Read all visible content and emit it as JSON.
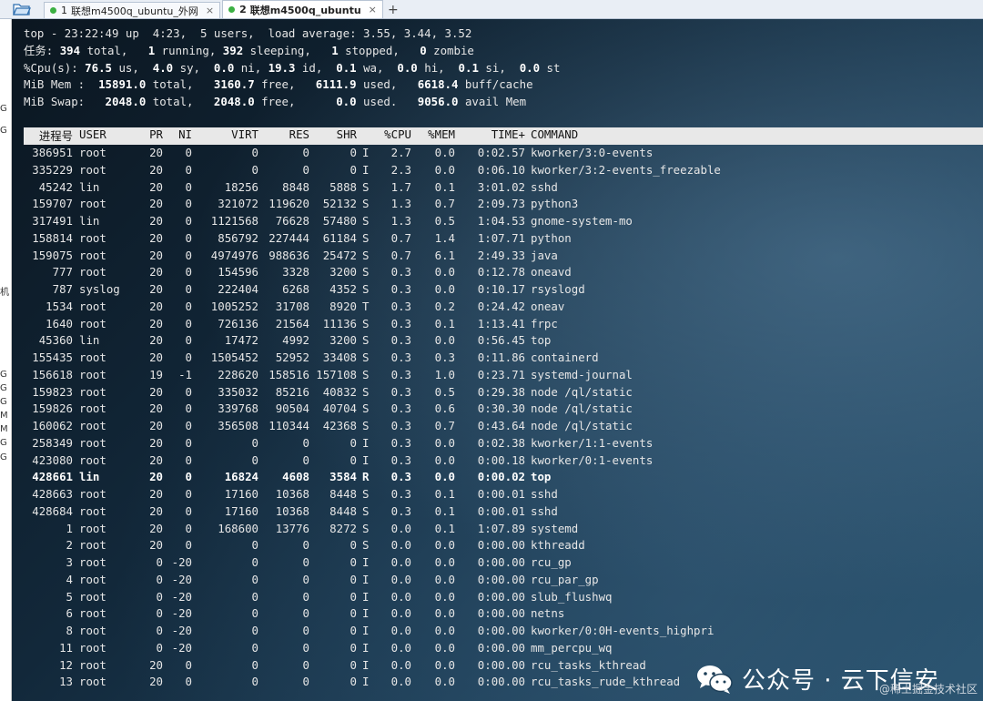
{
  "tabs": [
    {
      "index": "1",
      "label": "联想m4500q_ubuntu_外网",
      "active": false,
      "close": "×"
    },
    {
      "index": "2",
      "label": "联想m4500q_ubuntu",
      "active": true,
      "close": "×"
    }
  ],
  "add_tab": "+",
  "left_strip_chars": [
    "G",
    "G",
    "机",
    "G",
    "G",
    "G",
    "M",
    "M",
    "G",
    "G"
  ],
  "summary": {
    "line1": "top - 23:22:49 up  4:23,  5 users,  load average: 3.55, 3.44, 3.52",
    "tasks": {
      "label": "任务:",
      "total": "394",
      "total_lbl": " total,",
      "running": "1",
      "running_lbl": " running,",
      "sleeping": "392",
      "sleeping_lbl": " sleeping,",
      "stopped": "1",
      "stopped_lbl": " stopped,",
      "zombie": "0",
      "zombie_lbl": " zombie"
    },
    "cpu": {
      "label": "%Cpu(s):",
      "us": "76.5",
      "sy": "4.0",
      "ni": "0.0",
      "id": "19.3",
      "wa": "0.1",
      "hi": "0.0",
      "si": "0.1",
      "st": "0.0"
    },
    "mem": {
      "label": "MiB Mem :",
      "total": "15891.0",
      "free": "3160.7",
      "used": "6111.9",
      "buff": "6618.4"
    },
    "swap": {
      "label": "MiB Swap:",
      "total": "2048.0",
      "free": "2048.0",
      "used": "0.0",
      "avail": "9056.0"
    }
  },
  "columns": {
    "pid": "进程号",
    "user": "USER",
    "pr": "PR",
    "ni": "NI",
    "virt": "VIRT",
    "res": "RES",
    "shr": "SHR",
    "s": "",
    "cpu": "%CPU",
    "mem": "%MEM",
    "time": "TIME+",
    "cmd": "COMMAND"
  },
  "processes": [
    {
      "pid": "386951",
      "user": "root",
      "pr": "20",
      "ni": "0",
      "virt": "0",
      "res": "0",
      "shr": "0",
      "s": "I",
      "cpu": "2.7",
      "mem": "0.0",
      "time": "0:02.57",
      "cmd": "kworker/3:0-events"
    },
    {
      "pid": "335229",
      "user": "root",
      "pr": "20",
      "ni": "0",
      "virt": "0",
      "res": "0",
      "shr": "0",
      "s": "I",
      "cpu": "2.3",
      "mem": "0.0",
      "time": "0:06.10",
      "cmd": "kworker/3:2-events_freezable"
    },
    {
      "pid": "45242",
      "user": "lin",
      "pr": "20",
      "ni": "0",
      "virt": "18256",
      "res": "8848",
      "shr": "5888",
      "s": "S",
      "cpu": "1.7",
      "mem": "0.1",
      "time": "3:01.02",
      "cmd": "sshd"
    },
    {
      "pid": "159707",
      "user": "root",
      "pr": "20",
      "ni": "0",
      "virt": "321072",
      "res": "119620",
      "shr": "52132",
      "s": "S",
      "cpu": "1.3",
      "mem": "0.7",
      "time": "2:09.73",
      "cmd": "python3"
    },
    {
      "pid": "317491",
      "user": "lin",
      "pr": "20",
      "ni": "0",
      "virt": "1121568",
      "res": "76628",
      "shr": "57480",
      "s": "S",
      "cpu": "1.3",
      "mem": "0.5",
      "time": "1:04.53",
      "cmd": "gnome-system-mo"
    },
    {
      "pid": "158814",
      "user": "root",
      "pr": "20",
      "ni": "0",
      "virt": "856792",
      "res": "227444",
      "shr": "61184",
      "s": "S",
      "cpu": "0.7",
      "mem": "1.4",
      "time": "1:07.71",
      "cmd": "python"
    },
    {
      "pid": "159075",
      "user": "root",
      "pr": "20",
      "ni": "0",
      "virt": "4974976",
      "res": "988636",
      "shr": "25472",
      "s": "S",
      "cpu": "0.7",
      "mem": "6.1",
      "time": "2:49.33",
      "cmd": "java"
    },
    {
      "pid": "777",
      "user": "root",
      "pr": "20",
      "ni": "0",
      "virt": "154596",
      "res": "3328",
      "shr": "3200",
      "s": "S",
      "cpu": "0.3",
      "mem": "0.0",
      "time": "0:12.78",
      "cmd": "oneavd"
    },
    {
      "pid": "787",
      "user": "syslog",
      "pr": "20",
      "ni": "0",
      "virt": "222404",
      "res": "6268",
      "shr": "4352",
      "s": "S",
      "cpu": "0.3",
      "mem": "0.0",
      "time": "0:10.17",
      "cmd": "rsyslogd"
    },
    {
      "pid": "1534",
      "user": "root",
      "pr": "20",
      "ni": "0",
      "virt": "1005252",
      "res": "31708",
      "shr": "8920",
      "s": "T",
      "cpu": "0.3",
      "mem": "0.2",
      "time": "0:24.42",
      "cmd": "oneav"
    },
    {
      "pid": "1640",
      "user": "root",
      "pr": "20",
      "ni": "0",
      "virt": "726136",
      "res": "21564",
      "shr": "11136",
      "s": "S",
      "cpu": "0.3",
      "mem": "0.1",
      "time": "1:13.41",
      "cmd": "frpc"
    },
    {
      "pid": "45360",
      "user": "lin",
      "pr": "20",
      "ni": "0",
      "virt": "17472",
      "res": "4992",
      "shr": "3200",
      "s": "S",
      "cpu": "0.3",
      "mem": "0.0",
      "time": "0:56.45",
      "cmd": "top"
    },
    {
      "pid": "155435",
      "user": "root",
      "pr": "20",
      "ni": "0",
      "virt": "1505452",
      "res": "52952",
      "shr": "33408",
      "s": "S",
      "cpu": "0.3",
      "mem": "0.3",
      "time": "0:11.86",
      "cmd": "containerd"
    },
    {
      "pid": "156618",
      "user": "root",
      "pr": "19",
      "ni": "-1",
      "virt": "228620",
      "res": "158516",
      "shr": "157108",
      "s": "S",
      "cpu": "0.3",
      "mem": "1.0",
      "time": "0:23.71",
      "cmd": "systemd-journal"
    },
    {
      "pid": "159823",
      "user": "root",
      "pr": "20",
      "ni": "0",
      "virt": "335032",
      "res": "85216",
      "shr": "40832",
      "s": "S",
      "cpu": "0.3",
      "mem": "0.5",
      "time": "0:29.38",
      "cmd": "node /ql/static"
    },
    {
      "pid": "159826",
      "user": "root",
      "pr": "20",
      "ni": "0",
      "virt": "339768",
      "res": "90504",
      "shr": "40704",
      "s": "S",
      "cpu": "0.3",
      "mem": "0.6",
      "time": "0:30.30",
      "cmd": "node /ql/static"
    },
    {
      "pid": "160062",
      "user": "root",
      "pr": "20",
      "ni": "0",
      "virt": "356508",
      "res": "110344",
      "shr": "42368",
      "s": "S",
      "cpu": "0.3",
      "mem": "0.7",
      "time": "0:43.64",
      "cmd": "node /ql/static"
    },
    {
      "pid": "258349",
      "user": "root",
      "pr": "20",
      "ni": "0",
      "virt": "0",
      "res": "0",
      "shr": "0",
      "s": "I",
      "cpu": "0.3",
      "mem": "0.0",
      "time": "0:02.38",
      "cmd": "kworker/1:1-events"
    },
    {
      "pid": "423080",
      "user": "root",
      "pr": "20",
      "ni": "0",
      "virt": "0",
      "res": "0",
      "shr": "0",
      "s": "I",
      "cpu": "0.3",
      "mem": "0.0",
      "time": "0:00.18",
      "cmd": "kworker/0:1-events"
    },
    {
      "pid": "428661",
      "user": "lin",
      "pr": "20",
      "ni": "0",
      "virt": "16824",
      "res": "4608",
      "shr": "3584",
      "s": "R",
      "cpu": "0.3",
      "mem": "0.0",
      "time": "0:00.02",
      "cmd": "top",
      "bold": true
    },
    {
      "pid": "428663",
      "user": "root",
      "pr": "20",
      "ni": "0",
      "virt": "17160",
      "res": "10368",
      "shr": "8448",
      "s": "S",
      "cpu": "0.3",
      "mem": "0.1",
      "time": "0:00.01",
      "cmd": "sshd"
    },
    {
      "pid": "428684",
      "user": "root",
      "pr": "20",
      "ni": "0",
      "virt": "17160",
      "res": "10368",
      "shr": "8448",
      "s": "S",
      "cpu": "0.3",
      "mem": "0.1",
      "time": "0:00.01",
      "cmd": "sshd"
    },
    {
      "pid": "1",
      "user": "root",
      "pr": "20",
      "ni": "0",
      "virt": "168600",
      "res": "13776",
      "shr": "8272",
      "s": "S",
      "cpu": "0.0",
      "mem": "0.1",
      "time": "1:07.89",
      "cmd": "systemd"
    },
    {
      "pid": "2",
      "user": "root",
      "pr": "20",
      "ni": "0",
      "virt": "0",
      "res": "0",
      "shr": "0",
      "s": "S",
      "cpu": "0.0",
      "mem": "0.0",
      "time": "0:00.00",
      "cmd": "kthreadd"
    },
    {
      "pid": "3",
      "user": "root",
      "pr": "0",
      "ni": "-20",
      "virt": "0",
      "res": "0",
      "shr": "0",
      "s": "I",
      "cpu": "0.0",
      "mem": "0.0",
      "time": "0:00.00",
      "cmd": "rcu_gp"
    },
    {
      "pid": "4",
      "user": "root",
      "pr": "0",
      "ni": "-20",
      "virt": "0",
      "res": "0",
      "shr": "0",
      "s": "I",
      "cpu": "0.0",
      "mem": "0.0",
      "time": "0:00.00",
      "cmd": "rcu_par_gp"
    },
    {
      "pid": "5",
      "user": "root",
      "pr": "0",
      "ni": "-20",
      "virt": "0",
      "res": "0",
      "shr": "0",
      "s": "I",
      "cpu": "0.0",
      "mem": "0.0",
      "time": "0:00.00",
      "cmd": "slub_flushwq"
    },
    {
      "pid": "6",
      "user": "root",
      "pr": "0",
      "ni": "-20",
      "virt": "0",
      "res": "0",
      "shr": "0",
      "s": "I",
      "cpu": "0.0",
      "mem": "0.0",
      "time": "0:00.00",
      "cmd": "netns"
    },
    {
      "pid": "8",
      "user": "root",
      "pr": "0",
      "ni": "-20",
      "virt": "0",
      "res": "0",
      "shr": "0",
      "s": "I",
      "cpu": "0.0",
      "mem": "0.0",
      "time": "0:00.00",
      "cmd": "kworker/0:0H-events_highpri"
    },
    {
      "pid": "11",
      "user": "root",
      "pr": "0",
      "ni": "-20",
      "virt": "0",
      "res": "0",
      "shr": "0",
      "s": "I",
      "cpu": "0.0",
      "mem": "0.0",
      "time": "0:00.00",
      "cmd": "mm_percpu_wq"
    },
    {
      "pid": "12",
      "user": "root",
      "pr": "20",
      "ni": "0",
      "virt": "0",
      "res": "0",
      "shr": "0",
      "s": "I",
      "cpu": "0.0",
      "mem": "0.0",
      "time": "0:00.00",
      "cmd": "rcu_tasks_kthread"
    },
    {
      "pid": "13",
      "user": "root",
      "pr": "20",
      "ni": "0",
      "virt": "0",
      "res": "0",
      "shr": "0",
      "s": "I",
      "cpu": "0.0",
      "mem": "0.0",
      "time": "0:00.00",
      "cmd": "rcu_tasks_rude_kthread"
    }
  ],
  "watermark": {
    "main": "公众号 · 云下信安",
    "small": "@稀土掘金技术社区"
  },
  "colors": {
    "terminal_bg": "#12283a",
    "header_bg": "#e8e8e8",
    "text": "#e6e6e6",
    "tab_dot": "#3cb043"
  }
}
